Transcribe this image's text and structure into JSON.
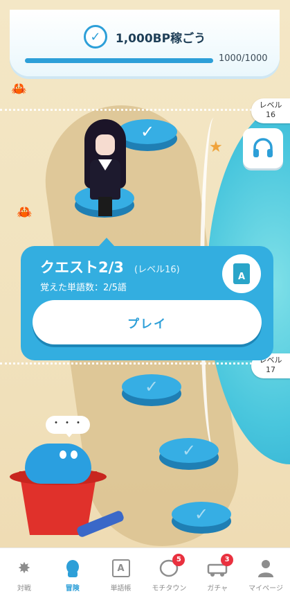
{
  "goal": {
    "title": "1,000BP稼ごう",
    "progress_text": "1000/1000",
    "progress_fraction": 1.0
  },
  "levels": {
    "upper": "レベル\n16",
    "upper_label": "レベル",
    "upper_number": "16",
    "lower_label": "レベル",
    "lower_number": "17"
  },
  "quest": {
    "title": "クエスト2/3",
    "level": "(レベル16)",
    "words_learned": "覚えた単語数：2/5語",
    "play_label": "プレイ",
    "book_letter": "A"
  },
  "speech_bubble": "・・・",
  "nav": {
    "items": [
      {
        "label": "対戦",
        "icon": "battle-icon"
      },
      {
        "label": "冒険",
        "icon": "adventure-icon",
        "active": true
      },
      {
        "label": "単語帳",
        "icon": "wordbook-icon",
        "letter": "A"
      },
      {
        "label": "モチタウン",
        "icon": "town-icon",
        "badge": "5"
      },
      {
        "label": "ガチャ",
        "icon": "gacha-icon",
        "badge": "3"
      },
      {
        "label": "マイページ",
        "icon": "mypage-icon"
      }
    ]
  },
  "colors": {
    "accent": "#2d9fd8",
    "badge": "#e9313f",
    "sand": "#f1e2bd",
    "sea": "#49c6dd"
  }
}
